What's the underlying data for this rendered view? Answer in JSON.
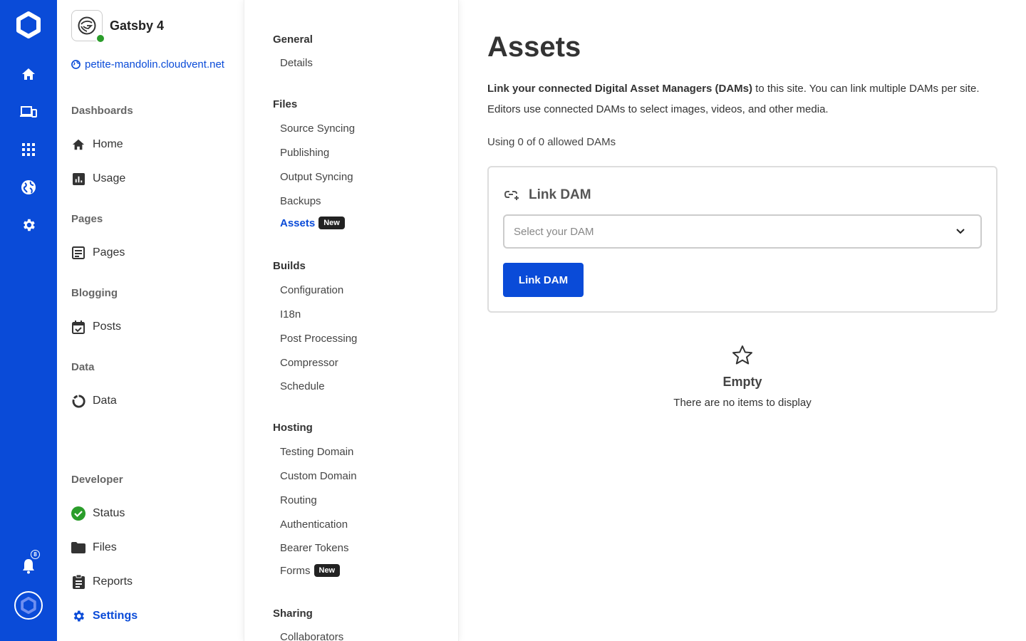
{
  "rail": {
    "notification_count": "8"
  },
  "site": {
    "name": "Gatsby 4",
    "url": "petite-mandolin.cloudvent.net"
  },
  "sidebar": {
    "sections": {
      "dashboards": "Dashboards",
      "pages": "Pages",
      "blogging": "Blogging",
      "data": "Data",
      "developer": "Developer"
    },
    "items": {
      "home": "Home",
      "usage": "Usage",
      "pages": "Pages",
      "posts": "Posts",
      "data": "Data",
      "status": "Status",
      "files": "Files",
      "reports": "Reports",
      "settings": "Settings"
    }
  },
  "settings_nav": {
    "badge_new": "New",
    "general": {
      "title": "General",
      "items": [
        "Details"
      ]
    },
    "files": {
      "title": "Files",
      "items": [
        "Source Syncing",
        "Publishing",
        "Output Syncing",
        "Backups",
        "Assets"
      ]
    },
    "builds": {
      "title": "Builds",
      "items": [
        "Configuration",
        "I18n",
        "Post Processing",
        "Compressor",
        "Schedule"
      ]
    },
    "hosting": {
      "title": "Hosting",
      "items": [
        "Testing Domain",
        "Custom Domain",
        "Routing",
        "Authentication",
        "Bearer Tokens",
        "Forms"
      ]
    },
    "sharing": {
      "title": "Sharing",
      "items": [
        "Collaborators"
      ]
    }
  },
  "main": {
    "title": "Assets",
    "intro_bold": "Link your connected Digital Asset Managers (DAMs)",
    "intro_rest": " to this site. You can link multiple DAMs per site. Editors use connected DAMs to select images, videos, and other media.",
    "usage": "Using 0 of 0 allowed DAMs",
    "card_title": "Link DAM",
    "select_placeholder": "Select your DAM",
    "button_label": "Link DAM",
    "empty_title": "Empty",
    "empty_subtitle": "There are no items to display"
  },
  "colors": {
    "brand": "#0a4bd8",
    "status_ok": "#2a9d2a"
  }
}
